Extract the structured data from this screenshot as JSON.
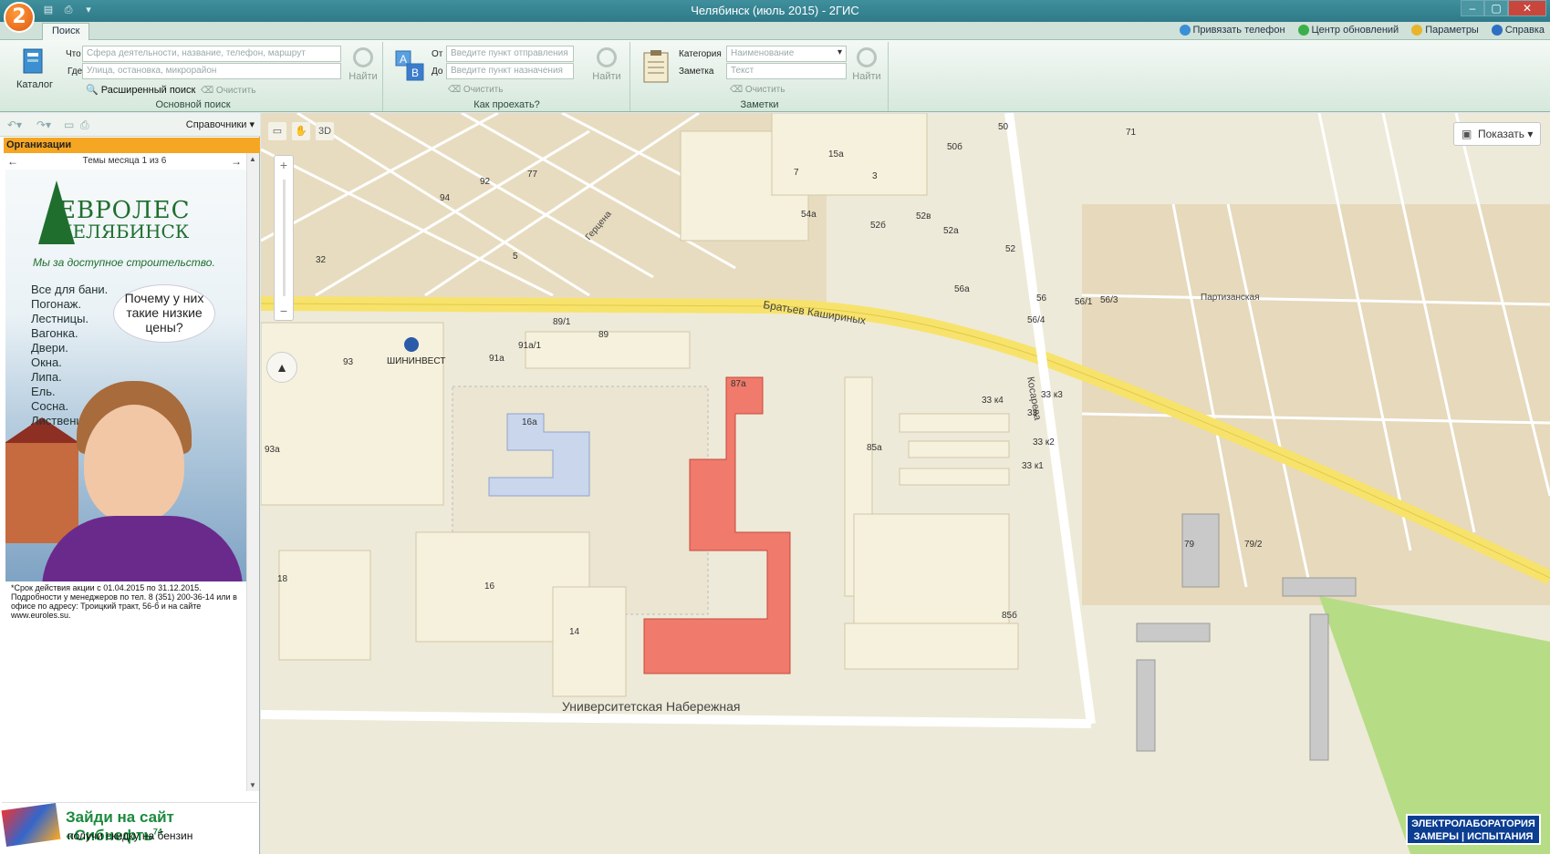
{
  "window": {
    "title": "Челябинск (июль 2015) - 2ГИС",
    "logo": "2"
  },
  "tabs": {
    "search": "Поиск"
  },
  "top_links": {
    "bind_phone": "Привязать телефон",
    "update_center": "Центр обновлений",
    "params": "Параметры",
    "help": "Справка"
  },
  "ribbon": {
    "main": {
      "catalog": "Каталог",
      "what_label": "Что",
      "what_placeholder": "Сфера деятельности, название, телефон, маршрут",
      "where_label": "Где",
      "where_placeholder": "Улица, остановка, микрорайон",
      "advanced": "Расширенный поиск",
      "clear": "Очистить",
      "find": "Найти",
      "group": "Основной поиск"
    },
    "route": {
      "from_label": "От",
      "from_placeholder": "Введите пункт отправления",
      "to_label": "До",
      "to_placeholder": "Введите пункт назначения",
      "clear": "Очистить",
      "find": "Найти",
      "group": "Как проехать?"
    },
    "notes": {
      "category_label": "Категория",
      "category_value": "Наименование",
      "note_label": "Заметка",
      "note_placeholder": "Текст",
      "clear": "Очистить",
      "find": "Найти",
      "group": "Заметки"
    }
  },
  "left_panel": {
    "directories": "Справочники",
    "organizations": "Организации",
    "month_topics": "Темы месяца 1 из 6",
    "ad": {
      "brand_line1": "ЕВРОЛЕС",
      "brand_line2": "ЧЕЛЯБИНСК",
      "slogan": "Мы за доступное строительство.",
      "items": [
        "Все для бани.",
        "Погонаж.",
        "Лестницы.",
        "Вагонка.",
        "Двери.",
        "Окна.",
        "Липа.",
        "Ель.",
        "Сосна.",
        "Лиственица."
      ],
      "bubble": "Почему у них такие низкие цены?",
      "fine_print": "*Срок действия акции с 01.04.2015 по 31.12.2015. Подробности у менеджеров по тел. 8 (351) 200-36-14 или в офисе по адресу: Троицкий тракт, 56-б и на сайте www.euroles.su."
    },
    "banner": {
      "line1": "Зайди на сайт «Сибнефть",
      "sup": "74",
      "line2": "получи скидку на бензин"
    }
  },
  "map": {
    "mode_3d": "3D",
    "show_button": "Показать",
    "streets": {
      "bratyev": "Братьев Кашириных",
      "universitet": "Университетская Набережная",
      "kosareva": "Косарева",
      "partizanskaya": "Партизанская",
      "gertsena": "Герцена"
    },
    "poi": "ШИНИНВЕСТ",
    "badge": [
      "ЭЛЕКТРОЛАБОРАТОРИЯ",
      "ЗАМЕРЫ | ИСПЫТАНИЯ"
    ],
    "buildings": {
      "b87a": "87а",
      "b89": "89",
      "b891": "89/1",
      "b91a1": "91а/1",
      "b91a": "91а",
      "b93": "93",
      "b93a": "93а",
      "b16a": "16а",
      "b16": "16",
      "b14": "14",
      "b18": "18",
      "b85a": "85а",
      "b85b": "85б",
      "b33": "33",
      "b33k1": "33 к1",
      "b33k2": "33 к2",
      "b33k3": "33 к3",
      "b33k4": "33 к4",
      "b56": "56",
      "b56a": "56а",
      "b564": "56/4",
      "b561": "56/1",
      "b563": "56/3",
      "b52": "52",
      "b52a": "52а",
      "b52b": "52б",
      "b52v": "52в",
      "b54a": "54а",
      "b15a": "15а",
      "b79": "79",
      "b792": "79/2",
      "b71": "71",
      "b50": "50",
      "b50b": "50б",
      "b3": "3",
      "b7": "7",
      "b32": "32",
      "b5": "5",
      "b77": "77",
      "b92": "92",
      "b94": "94"
    }
  }
}
